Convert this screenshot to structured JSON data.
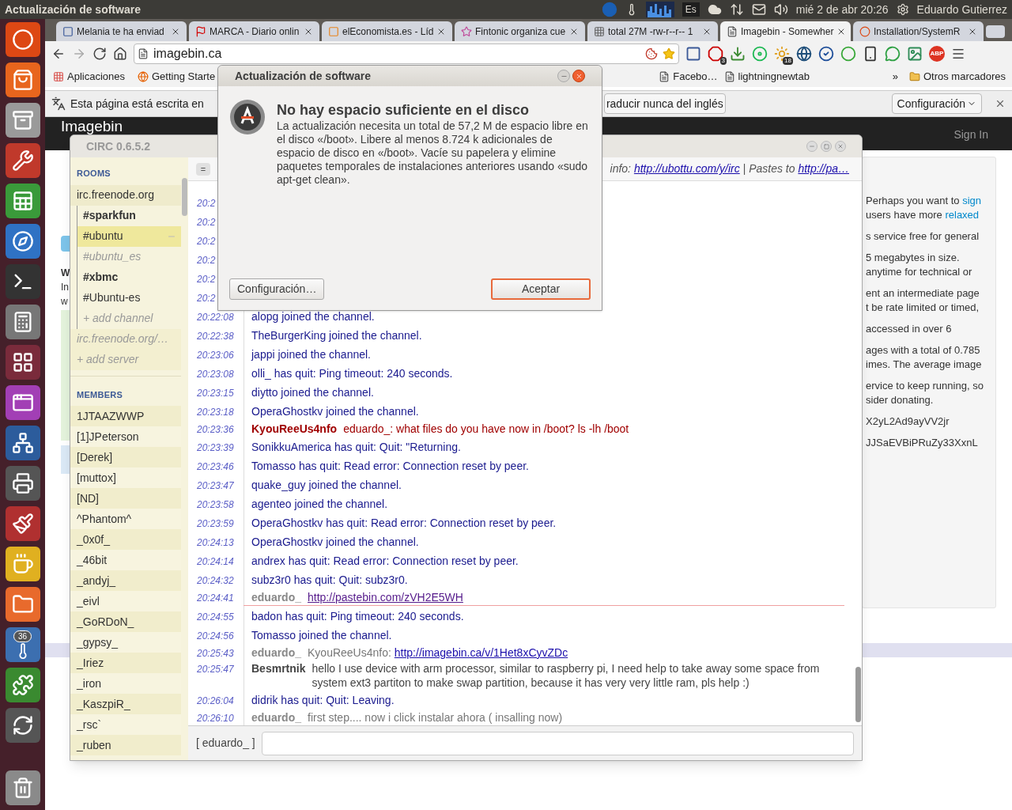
{
  "top_panel": {
    "title": "Actualización de software",
    "keyboard": "Es",
    "clock": "mié 2 de abr 20:26",
    "user": "Eduardo Gutierrez"
  },
  "launcher": {
    "items": [
      {
        "kind": "ubuntu"
      },
      {
        "kind": "store"
      },
      {
        "kind": "files"
      },
      {
        "kind": "settings"
      },
      {
        "kind": "spreadsheet"
      },
      {
        "kind": "browser"
      },
      {
        "kind": "terminal"
      },
      {
        "kind": "calculator"
      },
      {
        "kind": "workspaces"
      },
      {
        "kind": "window"
      },
      {
        "kind": "network"
      },
      {
        "kind": "scanner"
      },
      {
        "kind": "paint"
      },
      {
        "kind": "teapot"
      },
      {
        "kind": "folder"
      },
      {
        "kind": "thermometer",
        "badge": "36"
      },
      {
        "kind": "puzzle"
      },
      {
        "kind": "updater"
      },
      {
        "kind": "trash"
      }
    ]
  },
  "browser": {
    "tabs": [
      {
        "title": "Melania te ha enviad",
        "selected": false,
        "kind": "square"
      },
      {
        "title": "MARCA - Diario onlin",
        "selected": false,
        "kind": "flag"
      },
      {
        "title": "elEconomista.es - Líd",
        "selected": false,
        "kind": "tile"
      },
      {
        "title": "Fintonic organiza cue",
        "selected": false,
        "kind": "kite"
      },
      {
        "title": "total 27M -rw-r--r-- 1",
        "selected": false,
        "kind": "grid"
      },
      {
        "title": "Imagebin - Somewher",
        "selected": true,
        "kind": "page"
      },
      {
        "title": "Installation/SystemR",
        "selected": false,
        "kind": "ring"
      }
    ],
    "url": "imagebin.ca",
    "extensions": [
      {
        "kind": "square"
      },
      {
        "kind": "octagon",
        "badge": "3"
      },
      {
        "kind": "download"
      },
      {
        "kind": "disc"
      },
      {
        "kind": "weather",
        "badge": "18"
      },
      {
        "kind": "globe"
      },
      {
        "kind": "check"
      },
      {
        "kind": "ring"
      },
      {
        "kind": "phone"
      },
      {
        "kind": "bubble"
      },
      {
        "kind": "image"
      },
      {
        "kind": "adblock",
        "label": "ABP"
      }
    ],
    "bookmarks": [
      {
        "label": "Aplicaciones",
        "kind": "apps"
      },
      {
        "label": "Getting Starte",
        "kind": "fox"
      },
      {
        "label": "Facebo…",
        "kind": "page"
      },
      {
        "label": "lightningnewtab",
        "kind": "page"
      }
    ],
    "more": "»",
    "other_bookmarks": "Otros marcadores",
    "translate_bar": {
      "message": "Esta página está escrita en",
      "never_button": "raducir nunca del inglés",
      "settings_button": "Configuración"
    },
    "page": {
      "brand": "Imagebin",
      "sign_in": "Sign In",
      "left_fragments": [
        "W",
        "In",
        "w"
      ],
      "side_panel": [
        [
          {
            "text": "Perhaps you want to ",
            "link": "sign"
          },
          {
            "text": "users have more ",
            "link": "relaxed"
          }
        ],
        [
          {
            "text": "s service free for general"
          }
        ],
        [
          {
            "text": "5 megabytes in size."
          },
          {
            "text": "anytime for technical or"
          }
        ],
        [
          {
            "text": "ent an intermediate page"
          },
          {
            "text": "t be rate limited or timed,"
          }
        ],
        [
          {
            "text": "accessed in over 6"
          }
        ],
        [
          {
            "text": "ages with a total of 0.785"
          },
          {
            "text": "imes. The average image"
          }
        ],
        [
          {
            "text": "ervice to keep running, so"
          },
          {
            "text": "sider donating."
          }
        ],
        [
          {
            "text": "X2yL2Ad9ayVV2jr"
          }
        ],
        [
          {
            "text": "JJSaEVBiPRuZy33XxnL"
          }
        ]
      ]
    }
  },
  "circ": {
    "title": "CIRC 0.6.5.2",
    "sidebar": {
      "rooms_heading": "ROOMS",
      "servers": [
        {
          "name": "irc.freenode.org",
          "connected": true,
          "add_channel": "+ add channel",
          "channels": [
            {
              "name": "#sparkfun",
              "selected": false,
              "unread": true,
              "joined": true
            },
            {
              "name": "#ubuntu",
              "selected": true,
              "unread": false,
              "joined": true
            },
            {
              "name": "#ubuntu_es",
              "selected": false,
              "unread": false,
              "joined": false
            },
            {
              "name": "#xbmc",
              "selected": false,
              "unread": true,
              "joined": true
            },
            {
              "name": "#Ubuntu-es",
              "selected": false,
              "unread": false,
              "joined": true
            }
          ]
        },
        {
          "name": "irc.freenode.org/…",
          "connected": false
        }
      ],
      "add_server": "+ add server",
      "members_heading": "MEMBERS",
      "members": [
        "1JTAAZWWP",
        "[1]JPeterson",
        "[Derek]",
        "[muttox]",
        "[ND]",
        "^Phantom^",
        "_0x0f_",
        "_46bit",
        "_andyj_",
        "_eivl",
        "_GoRDoN_",
        "_gypsy_",
        "_Iriez",
        "_iron",
        "_KaszpiR_",
        "_rsc`",
        "_ruben"
      ]
    },
    "topic_button": "=",
    "topic": {
      "text": "info: ",
      "link": "http://ubottu.com/y/irc",
      "text2": " | Pastes to ",
      "link2": "http://pa…"
    },
    "messages": [
      {
        "kind": "event",
        "time": "20:2"
      },
      {
        "kind": "event",
        "time": "20:2"
      },
      {
        "kind": "event",
        "time": "20:2"
      },
      {
        "kind": "event",
        "time": "20:2"
      },
      {
        "kind": "event",
        "time": "20:2"
      },
      {
        "kind": "event",
        "time": "20:2"
      },
      {
        "kind": "event",
        "time": "20:22:08",
        "text": "alopg joined the channel."
      },
      {
        "kind": "event",
        "time": "20:22:38",
        "text": "TheBurgerKing joined the channel."
      },
      {
        "kind": "event",
        "time": "20:23:06",
        "text": "jappi joined the channel."
      },
      {
        "kind": "event",
        "time": "20:23:08",
        "text": "olli_ has quit: Ping timeout: 240 seconds."
      },
      {
        "kind": "event",
        "time": "20:23:15",
        "text": "diytto joined the channel."
      },
      {
        "kind": "event",
        "time": "20:23:18",
        "text": "OperaGhostkv joined the channel."
      },
      {
        "kind": "mention",
        "time": "20:23:36",
        "nick": "KyouReeUs4nfo",
        "text": "eduardo_: what files do you have now in /boot? ls -lh /boot"
      },
      {
        "kind": "event",
        "time": "20:23:39",
        "text": "SonikkuAmerica has quit: Quit: \"Returning."
      },
      {
        "kind": "event",
        "time": "20:23:46",
        "text": "Tomasso has quit: Read error: Connection reset by peer."
      },
      {
        "kind": "event",
        "time": "20:23:47",
        "text": "quake_guy joined the channel."
      },
      {
        "kind": "event",
        "time": "20:23:58",
        "text": "agenteo joined the channel."
      },
      {
        "kind": "event",
        "time": "20:23:59",
        "text": "OperaGhostkv has quit: Read error: Connection reset by peer."
      },
      {
        "kind": "event",
        "time": "20:24:13",
        "text": "OperaGhostkv joined the channel."
      },
      {
        "kind": "event",
        "time": "20:24:14",
        "text": "andrex has quit: Read error: Connection reset by peer."
      },
      {
        "kind": "event",
        "time": "20:24:32",
        "text": "subz3r0 has quit: Quit: subz3r0."
      },
      {
        "kind": "self",
        "time": "20:24:41",
        "nick": "eduardo_",
        "link": "http://pastebin.com/zVH2E5WH",
        "visited": true
      },
      {
        "kind": "divider"
      },
      {
        "kind": "event",
        "time": "20:24:55",
        "text": "badon has quit: Ping timeout: 240 seconds."
      },
      {
        "kind": "event",
        "time": "20:24:56",
        "text": "Tomasso joined the channel."
      },
      {
        "kind": "self",
        "time": "20:25:43",
        "nick": "eduardo_",
        "text": "KyouReeUs4nfo: ",
        "link": "http://imagebin.ca/v/1Het8xCyvZDc",
        "visited": false
      },
      {
        "kind": "message",
        "time": "20:25:47",
        "nick": "Besmrtnik",
        "text": "hello I use device with arm processor, similar to raspberry pi, I need help to take away some space from system ext3 partiton to make swap partition, because it has very very little ram, pls help :)"
      },
      {
        "kind": "event",
        "time": "20:26:04",
        "text": "didrik has quit: Quit: Leaving."
      },
      {
        "kind": "self",
        "time": "20:26:10",
        "nick": "eduardo_",
        "text": "first step.... now i click instalar ahora ( insalling now)"
      }
    ],
    "nick_label": "[ eduardo_ ]"
  },
  "dialog": {
    "title": "Actualización de software",
    "heading": "No hay espacio suficiente en el disco",
    "body": "La actualización necesita un total de 57,2 M de espacio libre en el disco «/boot». Libere al menos 8.724 k adicionales de espacio de disco en «/boot». Vacíe su papelera y elimine paquetes temporales de instalaciones anteriores usando «sudo apt-get clean».",
    "buttons": [
      {
        "label": "Configuración…",
        "default": false
      },
      {
        "label": "Aceptar",
        "default": true
      }
    ]
  }
}
